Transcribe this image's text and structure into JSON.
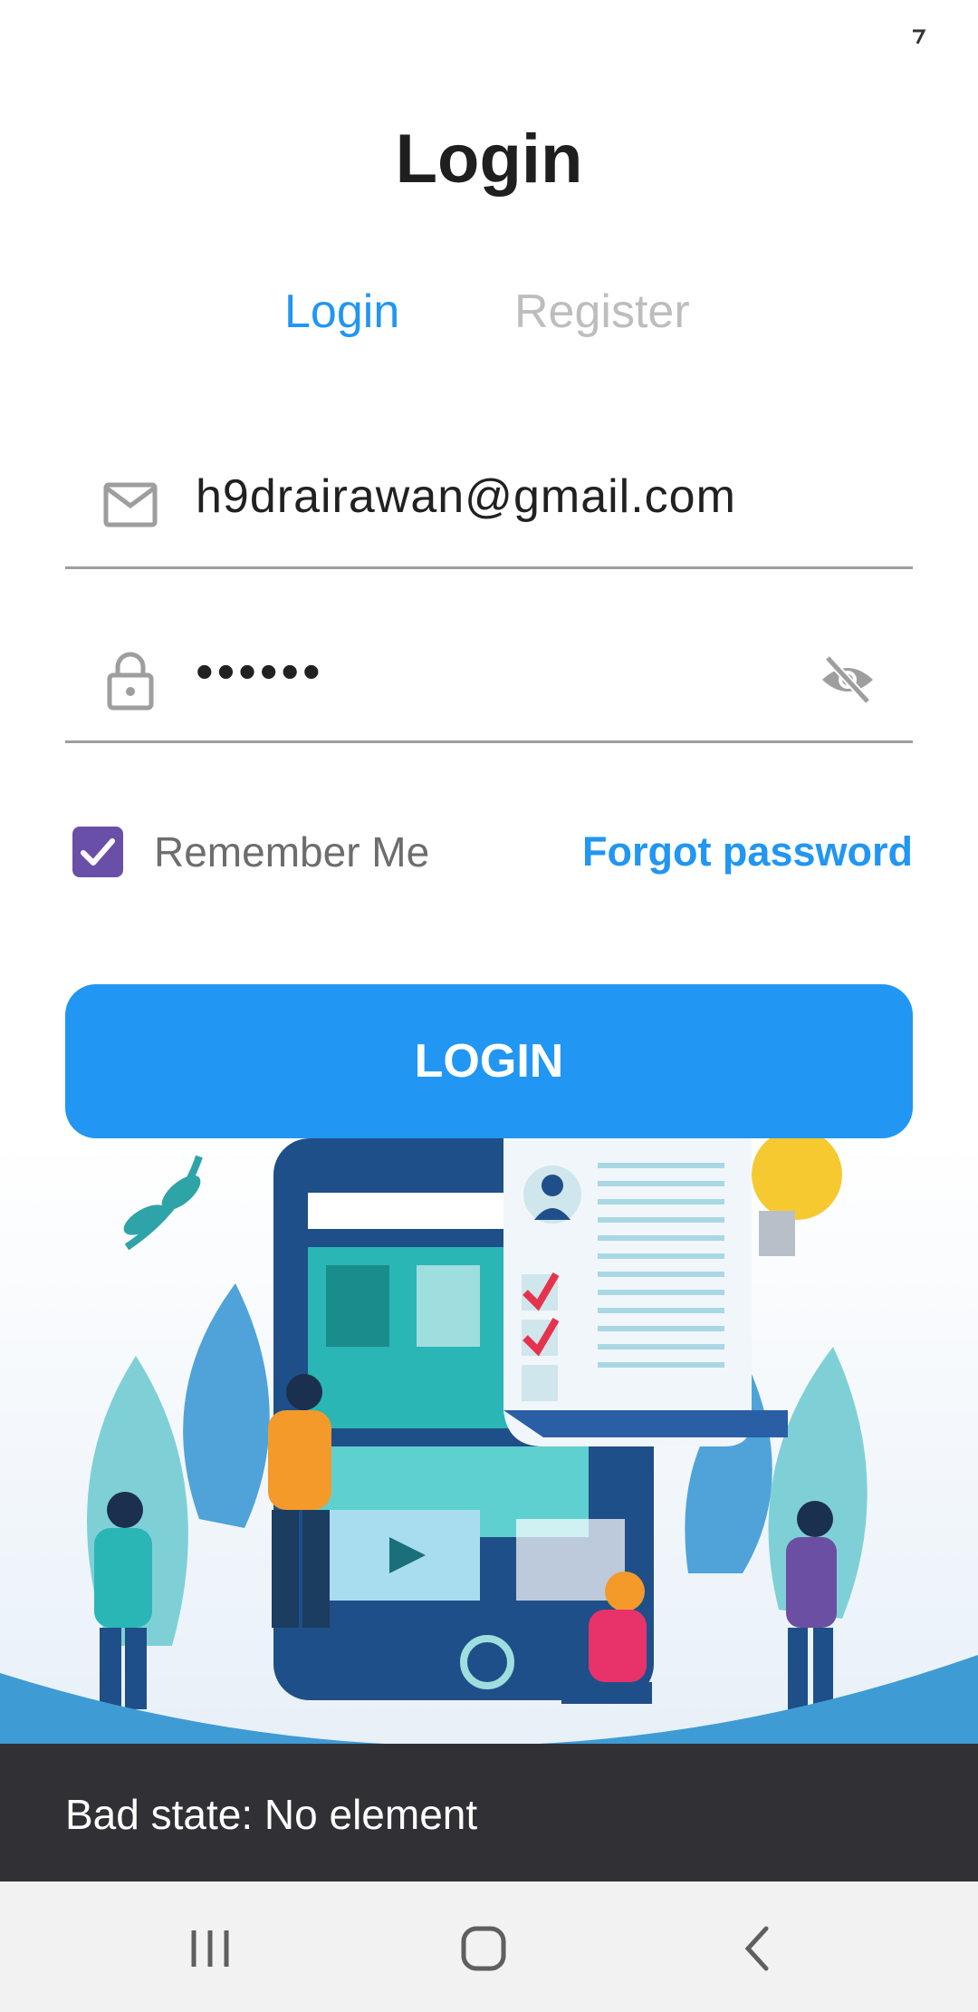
{
  "header": {
    "title": "Login"
  },
  "tabs": [
    {
      "label": "Login",
      "active": true
    },
    {
      "label": "Register",
      "active": false
    }
  ],
  "form": {
    "email_value": "h9drairawan@gmail.com",
    "password_masked": "••••••",
    "remember_label": "Remember Me",
    "remember_checked": true,
    "forgot_label": "Forgot password",
    "submit_label": "LOGIN"
  },
  "snackbar": {
    "message": "Bad state: No element"
  },
  "icons": [
    "status-icon",
    "mail-icon",
    "lock-icon",
    "eye-off-icon",
    "check-icon",
    "recents-icon",
    "home-icon",
    "back-icon"
  ],
  "colors": {
    "accent": "#2196f3",
    "checkbox": "#6a4fa8",
    "snackbar": "#313034",
    "inactive_tab": "#bdbdbd"
  }
}
